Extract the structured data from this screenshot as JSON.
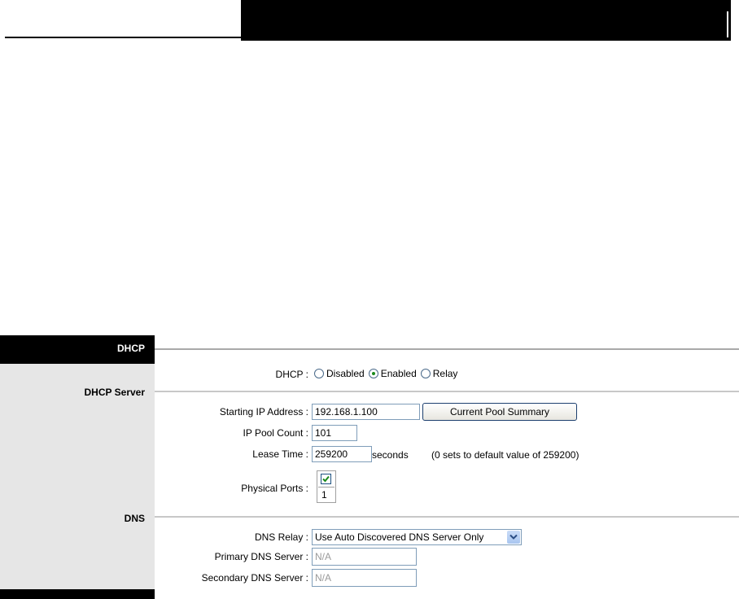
{
  "sidebar": {
    "title": "DHCP",
    "dhcp_server_label": "DHCP Server",
    "dns_label": "DNS"
  },
  "dhcp": {
    "label": "DHCP :",
    "options": [
      {
        "label": "Disabled",
        "selected": false
      },
      {
        "label": "Enabled",
        "selected": true
      },
      {
        "label": "Relay",
        "selected": false
      }
    ]
  },
  "dhcp_server": {
    "start_ip_label": "Starting IP Address :",
    "start_ip_value": "192.168.1.100",
    "pool_summary_button": "Current Pool Summary",
    "pool_count_label": "IP Pool Count :",
    "pool_count_value": "101",
    "lease_label": "Lease Time :",
    "lease_value": "259200",
    "lease_units": "seconds",
    "lease_hint": "(0 sets to default value of 259200)",
    "ports_label": "Physical Ports :",
    "port_number": "1",
    "port_checked": true
  },
  "dns": {
    "relay_label": "DNS Relay :",
    "relay_value": "Use Auto Discovered DNS Server Only",
    "primary_label": "Primary DNS Server :",
    "primary_value": "N/A",
    "secondary_label": "Secondary DNS Server :",
    "secondary_value": "N/A"
  },
  "colors": {
    "sidebar_bg": "#e6e6e6",
    "header_bg": "#000000",
    "checkbox_green": "#1a8a1a"
  },
  "icons": {
    "radio_selected": "radio-dot",
    "checkbox": "check-mark-icon",
    "dropdown": "chevron-down-icon"
  }
}
